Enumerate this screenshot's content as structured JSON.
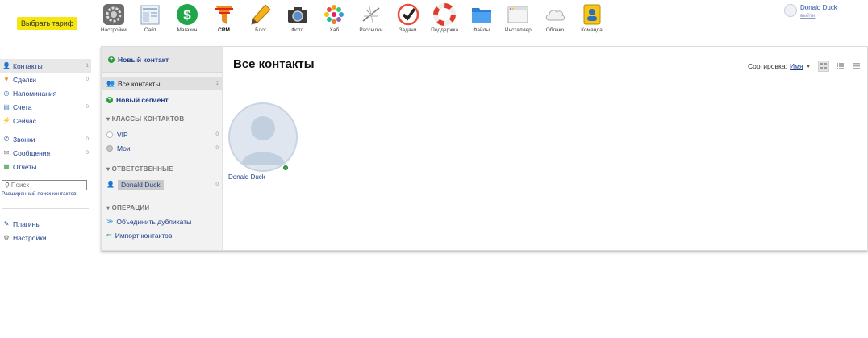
{
  "header": {
    "tariff_button": "Выбрать тариф",
    "apps": [
      {
        "label": "Настройки",
        "icon": "gear-icon"
      },
      {
        "label": "Сайт",
        "icon": "site-icon"
      },
      {
        "label": "Магазин",
        "icon": "shop-icon"
      },
      {
        "label": "CRM",
        "icon": "crm-funnel-icon"
      },
      {
        "label": "Блог",
        "icon": "pencil-icon"
      },
      {
        "label": "Фото",
        "icon": "camera-icon"
      },
      {
        "label": "Хаб",
        "icon": "hub-icon"
      },
      {
        "label": "Рассылки",
        "icon": "mailer-icon"
      },
      {
        "label": "Задачи",
        "icon": "checkmark-icon"
      },
      {
        "label": "Поддержка",
        "icon": "lifebuoy-icon"
      },
      {
        "label": "Файлы",
        "icon": "folder-icon"
      },
      {
        "label": "Инсталлер",
        "icon": "installer-icon"
      },
      {
        "label": "Облако",
        "icon": "cloud-icon"
      },
      {
        "label": "Команда",
        "icon": "team-icon"
      }
    ],
    "active_app": "CRM",
    "user": {
      "name": "Donald Duck",
      "logout": "выйти"
    }
  },
  "left_nav": {
    "items": [
      {
        "label": "Контакты",
        "count": "1",
        "icon": "contacts-icon"
      },
      {
        "label": "Сделки",
        "count": "0",
        "icon": "deals-funnel-icon"
      },
      {
        "label": "Напоминания",
        "count": "",
        "icon": "clock-icon"
      },
      {
        "label": "Счета",
        "count": "0",
        "icon": "invoice-icon"
      },
      {
        "label": "Сейчас",
        "count": "",
        "icon": "lightning-icon"
      },
      {
        "label": "Звонки",
        "count": "0",
        "icon": "phone-icon"
      },
      {
        "label": "Сообщения",
        "count": "0",
        "icon": "envelope-icon"
      },
      {
        "label": "Отчеты",
        "count": "",
        "icon": "reports-icon"
      }
    ],
    "search_placeholder": "Поиск",
    "advanced_search": "Расширенный поиск контактов",
    "bottom": [
      {
        "label": "Плагины",
        "icon": "plugin-icon"
      },
      {
        "label": "Настройки",
        "icon": "settings-gear-icon"
      }
    ]
  },
  "sidebar": {
    "new_contact": "Новый контакт",
    "all_contacts": {
      "label": "Все контакты",
      "count": "1"
    },
    "new_segment": "Новый сегмент",
    "classes_title": "▾ КЛАССЫ КОНТАКТОВ",
    "classes": [
      {
        "label": "VIP",
        "count": "0",
        "color": "#ffffff"
      },
      {
        "label": "Мои",
        "count": "0",
        "color": "#c4c4c4"
      }
    ],
    "responsible_title": "▾ ОТВЕТСТВЕННЫЕ",
    "responsible": [
      {
        "label": "Donald Duck",
        "count": "0"
      }
    ],
    "operations_title": "▾ ОПЕРАЦИИ",
    "operations": [
      {
        "label": "Объединить дубликаты",
        "icon": "merge-arrows-icon"
      },
      {
        "label": "Импорт контактов",
        "icon": "import-arrow-icon"
      }
    ]
  },
  "main": {
    "title": "Все контакты",
    "sort_label": "Сортировка:",
    "sort_value": "Имя",
    "contact": {
      "name": "Donald Duck",
      "status_color": "#3aa845"
    }
  }
}
